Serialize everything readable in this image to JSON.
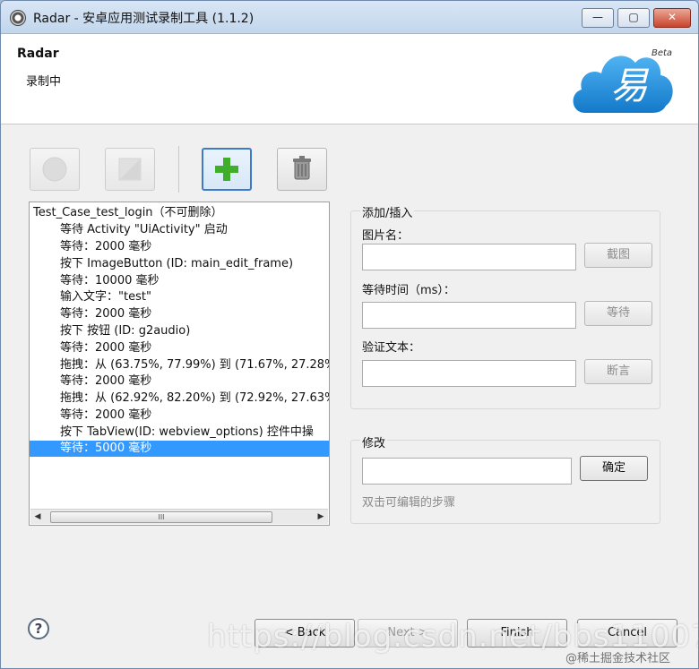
{
  "window": {
    "title": "Radar - 安卓应用测试录制工具 (1.1.2)",
    "min_label": "—",
    "max_label": "▢",
    "close_label": "✕"
  },
  "header": {
    "title": "Radar",
    "subtitle": "录制中",
    "logo_badge": "Beta",
    "logo_glyph": "易"
  },
  "tree": {
    "root": "Test_Case_test_login（不可删除）",
    "steps": [
      "等待 Activity  \"UiActivity\"  启动",
      "等待：2000 毫秒",
      "按下 ImageButton (ID: main_edit_frame)",
      "等待：10000 毫秒",
      "输入文字：\"test\"",
      "等待：2000 毫秒",
      "按下 按钮 (ID: g2audio)",
      "等待：2000 毫秒",
      "拖拽：从 (63.75%, 77.99%) 到 (71.67%, 27.28%",
      "等待：2000 毫秒",
      "拖拽：从 (62.92%, 82.20%) 到 (72.92%, 27.63%",
      "等待：2000 毫秒",
      "按下 TabView(ID: webview_options) 控件中操",
      "等待：5000 毫秒"
    ],
    "selected_index": 13,
    "scroll_thumb_label": "III"
  },
  "add_insert": {
    "group_label": "添加/插入",
    "image_name_label": "图片名：",
    "image_name_value": "",
    "screenshot_button": "截图",
    "wait_time_label": "等待时间（ms）：",
    "wait_time_value": "",
    "wait_button": "等待",
    "verify_text_label": "验证文本：",
    "verify_text_value": "",
    "assert_button": "断言"
  },
  "modify": {
    "group_label": "修改",
    "value": "",
    "confirm_button": "确定",
    "hint": "双击可编辑的步骤"
  },
  "footer": {
    "help_label": "?",
    "back_label": "< Back",
    "next_label": "Next >",
    "finish_label": "Finish",
    "cancel_label": "Cancel"
  },
  "overlay": {
    "watermark": "https://blog.csdn.net/bbs11007",
    "credit": "@稀土掘金技术社区"
  },
  "colors": {
    "selection": "#3399ff",
    "add_icon": "#3fae2a"
  }
}
